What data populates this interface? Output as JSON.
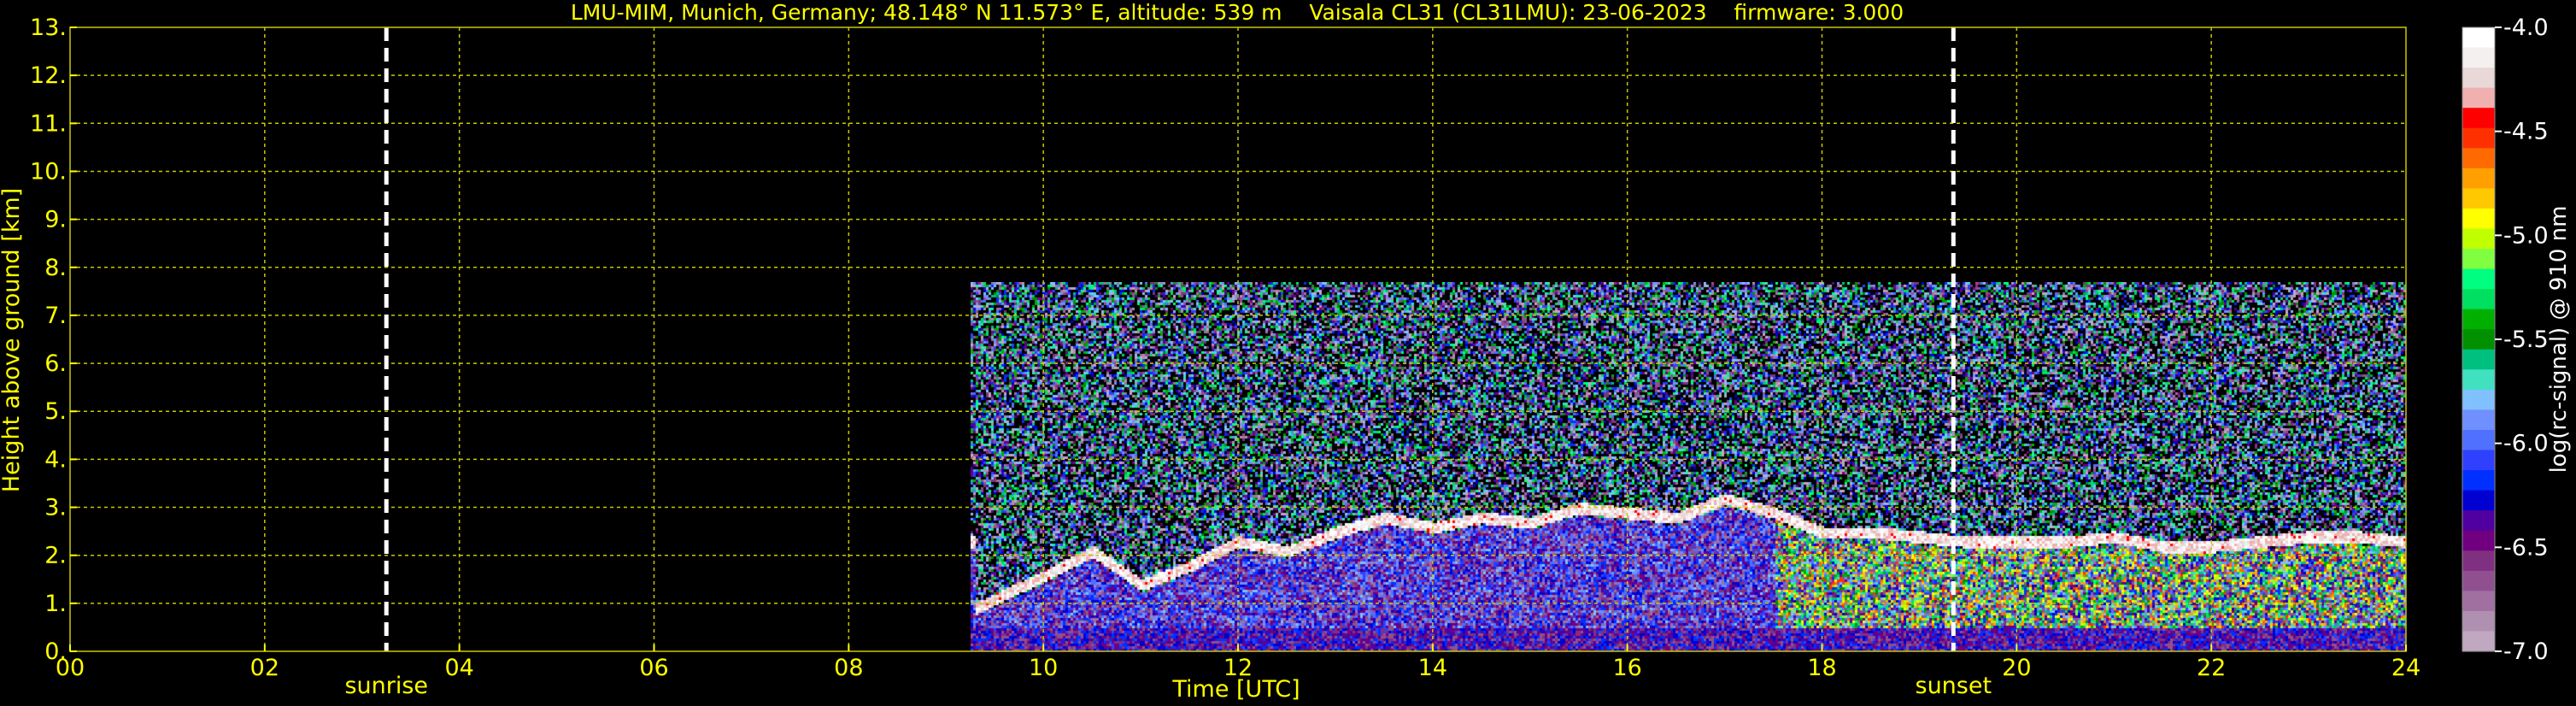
{
  "chart_data": {
    "type": "heatmap",
    "title": "LMU-MIM, Munich, Germany; 48.148° N 11.573° E, altitude: 539 m    Vaisala CL31 (CL31LMU): 23-06-2023    firmware: 3.000",
    "xlabel": "Time [UTC]",
    "ylabel": "Height above ground [km]",
    "xlim": [
      0,
      24
    ],
    "ylim": [
      0,
      13
    ],
    "x_ticks": [
      "00",
      "02",
      "04",
      "06",
      "08",
      "10",
      "12",
      "14",
      "16",
      "18",
      "20",
      "22",
      "24"
    ],
    "y_ticks": [
      "0.",
      "1.",
      "2.",
      "3.",
      "4.",
      "5.",
      "6.",
      "7.",
      "8.",
      "9.",
      "10.",
      "11.",
      "12.",
      "13."
    ],
    "grid": true,
    "annotations": [
      {
        "label": "sunrise",
        "x": 3.25
      },
      {
        "label": "sunset",
        "x": 19.35
      }
    ],
    "data_extent": {
      "time_start": 9.25,
      "time_end": 24,
      "height_max": 7.7
    },
    "boundary_layer_top": {
      "time": [
        9.3,
        10,
        10.5,
        11,
        11.5,
        12,
        12.5,
        13,
        13.5,
        14,
        14.5,
        15,
        15.5,
        16,
        16.5,
        17,
        17.5,
        18,
        18.5,
        19,
        19.5,
        20,
        20.5,
        21,
        21.5,
        22,
        22.5,
        23,
        23.5,
        24
      ],
      "height": [
        0.9,
        1.6,
        2.1,
        1.4,
        1.8,
        2.3,
        2.1,
        2.5,
        2.8,
        2.6,
        2.8,
        2.7,
        3.0,
        2.9,
        2.8,
        3.2,
        2.9,
        2.5,
        2.5,
        2.4,
        2.3,
        2.3,
        2.3,
        2.4,
        2.2,
        2.2,
        2.3,
        2.4,
        2.4,
        2.3
      ]
    },
    "colorbar": {
      "label": "log(rc-signal) @ 910 nm",
      "range": [
        -7.0,
        -4.0
      ],
      "ticks": [
        "-4.0",
        "-4.5",
        "-5.0",
        "-5.5",
        "-6.0",
        "-6.5",
        "-7.0"
      ],
      "colors": [
        "#ffffff",
        "#f4f0f0",
        "#e8d8d8",
        "#f0b0b0",
        "#ff0000",
        "#ff3000",
        "#ff6a00",
        "#ffa000",
        "#ffc800",
        "#ffff00",
        "#c0ff00",
        "#80ff40",
        "#00ff80",
        "#00e060",
        "#00b000",
        "#009000",
        "#00c080",
        "#40e0c0",
        "#80c0ff",
        "#7090ff",
        "#5070ff",
        "#3040ff",
        "#0030ff",
        "#0000d0",
        "#5000a0",
        "#700080",
        "#803080",
        "#905090",
        "#a070a0",
        "#b090b0",
        "#c0a8c0"
      ]
    }
  }
}
